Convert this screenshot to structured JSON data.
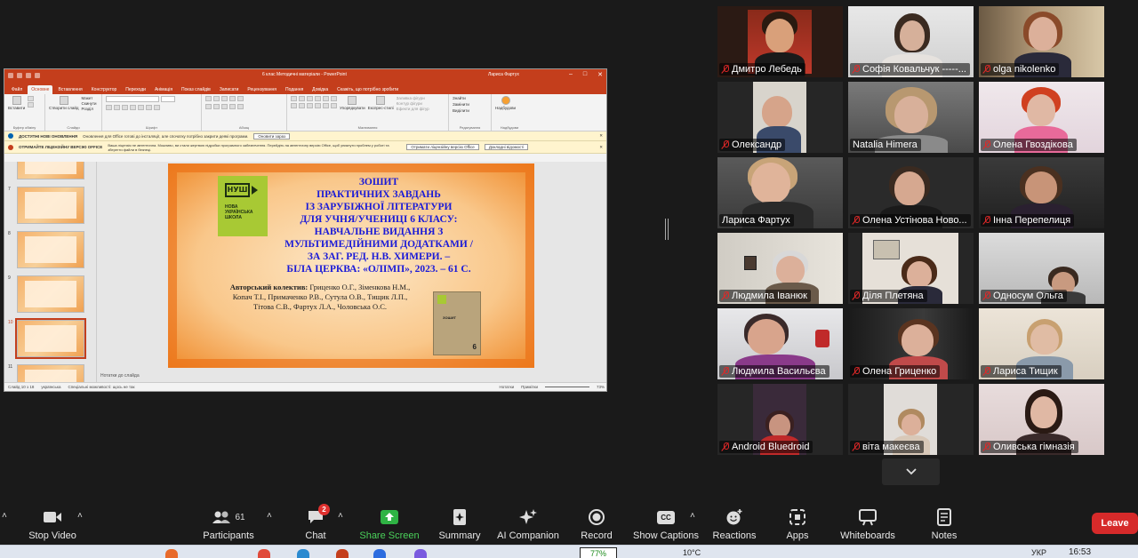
{
  "ppt": {
    "doc_title": "6 клас Методичні матеріали  -  PowerPoint",
    "user_name": "Лариса Фартух",
    "menu": [
      "Файл",
      "Основне",
      "Вставлення",
      "Конструктор",
      "Переходи",
      "Анімація",
      "Показ слайдів",
      "Записати",
      "Рецензування",
      "Подання",
      "Довідка",
      "Скажіть, що потрібно зробити"
    ],
    "ribbon": {
      "insert": "Вставити",
      "create_slide": "Створити слайд",
      "layout": "Макет",
      "reset": "Скинути",
      "section": "Розділ",
      "group_clipboard": "Буфер обміну",
      "group_slides": "Слайди",
      "group_font": "Шрифт",
      "group_paragraph": "Абзац",
      "group_drawing": "Малювання",
      "group_editing": "Редагування",
      "group_addins": "Надбудови",
      "arrange": "Упорядкувати",
      "quick_styles": "Експрес-стилі",
      "find": "Знайти",
      "replace": "Замінити",
      "select": "Виділити",
      "addins": "Надбудови",
      "shape_fill": "Заливка фігури",
      "shape_outline": "Контур фігури",
      "shape_effects": "Ефекти для фігур"
    },
    "info1": {
      "title": "ДОСТУПНІ НОВІ ОНОВЛЕННЯ",
      "text": "Оновлення для Office готові до інсталяції, але спочатку потрібно закрити деякі програми.",
      "button": "Оновити зараз"
    },
    "info2": {
      "title": "ОТРИМАЙТЕ ЛІЦЕНЗІЙНУ ВЕРСІЮ OFFICE",
      "text": "Ваша ліцензія не автентична. Можливо, ви стали жертвою підробки програмного забезпечення. Перейдіть на автентичну версію Office, щоб уникнути проблем у роботі та зберегти файли в безпеці.",
      "button1": "Отримати ліцензійну версію Office",
      "button2": "Докладні відомості"
    },
    "thumb_numbers": [
      "7",
      "8",
      "9",
      "10",
      "11"
    ],
    "slide": {
      "logo_mark": "НУШ",
      "logo_text": "НОВА УКРАЇНСЬКА ШКОЛА",
      "heading_lines": [
        "ЗОШИТ",
        "ПРАКТИЧНИХ ЗАВДАНЬ",
        "ІЗ ЗАРУБІЖНОЇ ЛІТЕРАТУРИ",
        "ДЛЯ УЧНЯ/УЧЕНИЦІ 6 КЛАСУ:",
        "НАВЧАЛЬНЕ ВИДАННЯ З",
        "МУЛЬТИМЕДІЙНИМИ ДОДАТКАМИ /",
        "ЗА ЗАГ. РЕД. Н.В. ХИМЕРИ. –",
        "БІЛА ЦЕРКВА: «ОЛІМП», 2023. – 61 С."
      ],
      "authors_label": "Авторський колектив:",
      "authors_line1": " Гриценко О.Г., Зіменкова Н.М.,",
      "authors_line2": "Копач Т.І., Примаченко Р.В., Сутула О.В., Тищик Л.П.,",
      "authors_line3": "Тітова С.В.,  Фартух Л.А., Чоловська О.С.",
      "book_title": "ЗОШИТ",
      "book_number": "6"
    },
    "notes": "Нотатки до слайда",
    "status_left": "Слайд 10 з 18",
    "status_lang": "українська",
    "status_access": "Спеціальні можливості: щось не так",
    "status_notes": "Нотатки",
    "status_comments": "Примітки",
    "zoom": "73%"
  },
  "participants": [
    {
      "name": "Дмитро Лебедь",
      "muted": true
    },
    {
      "name": "Софія Ковальчук -----...",
      "muted": true
    },
    {
      "name": "olga nikolenko",
      "muted": true
    },
    {
      "name": "Олександр",
      "muted": true
    },
    {
      "name": "Natalia Himera",
      "muted": false
    },
    {
      "name": "Олена Гвоздікова",
      "muted": true
    },
    {
      "name": "Лариса Фартух",
      "muted": false
    },
    {
      "name": "Олена Устінова Ново...",
      "muted": true
    },
    {
      "name": "Інна Перепелиця",
      "muted": true
    },
    {
      "name": "Людмила Іванюк",
      "muted": true
    },
    {
      "name": "Діля Плетяна",
      "muted": true
    },
    {
      "name": "Односум Ольга",
      "muted": true
    },
    {
      "name": "Людмила Васильєва",
      "muted": true
    },
    {
      "name": "Олена Гриценко",
      "muted": true
    },
    {
      "name": "Лариса Тищик",
      "muted": true
    },
    {
      "name": "Android Bluedroid",
      "muted": true
    },
    {
      "name": "віта макеєва",
      "muted": true
    },
    {
      "name": "Оливська гімназія",
      "muted": true
    }
  ],
  "toolbar": {
    "stop_video": "Stop Video",
    "participants": "Participants",
    "participants_count": "61",
    "chat": "Chat",
    "chat_badge": "2",
    "share_screen": "Share Screen",
    "summary": "Summary",
    "ai_companion": "AI Companion",
    "record": "Record",
    "show_captions": "Show Captions",
    "captions_icon": "CC",
    "reactions": "Reactions",
    "apps": "Apps",
    "whiteboards": "Whiteboards",
    "notes": "Notes",
    "leave": "Leave"
  },
  "taskbar": {
    "clock": "16:53",
    "lang": "УКР",
    "temp": "10°C",
    "battery": "77%"
  }
}
